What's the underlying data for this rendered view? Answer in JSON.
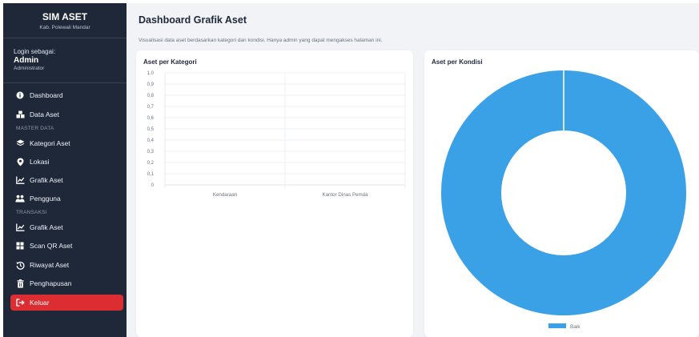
{
  "brand": {
    "title": "SIM ASET",
    "subtitle": "Kab. Polewali Mandar"
  },
  "login": {
    "label": "Login sebagai:",
    "name": "Admin",
    "role": "Administrator"
  },
  "sidebar": {
    "items": [
      {
        "label": "Dashboard",
        "icon": "info-circle-icon"
      },
      {
        "label": "Data Aset",
        "icon": "boxes-icon"
      },
      {
        "label": "Kategori Aset",
        "icon": "layers-icon"
      },
      {
        "label": "Lokasi",
        "icon": "map-pin-icon"
      },
      {
        "label": "Grafik Aset",
        "icon": "line-chart-icon"
      },
      {
        "label": "Pengguna",
        "icon": "users-icon"
      },
      {
        "label": "Grafik Aset",
        "icon": "line-chart-icon"
      },
      {
        "label": "Scan QR Aset",
        "icon": "qr-code-icon"
      },
      {
        "label": "Riwayat Aset",
        "icon": "history-icon"
      },
      {
        "label": "Penghapusan",
        "icon": "trash-icon"
      },
      {
        "label": "Keluar",
        "icon": "logout-icon"
      }
    ],
    "sections": {
      "master": "MASTER DATA",
      "transaksi": "TRANSAKSI"
    }
  },
  "header": {
    "title": "Dashboard Grafik Aset",
    "subtitle": "Visualisasi data aset berdasarkan kategori dan kondisi. Hanya admin yang dapat mengakses halaman ini."
  },
  "colors": {
    "sidebar_bg": "#1f2838",
    "accent": "#3ba1e6",
    "logout": "#dc2d32"
  },
  "chart_data": [
    {
      "type": "bar",
      "title": "Aset per Kategori",
      "categories": [
        "Kendaraan",
        "Kantor Dinas Pemda"
      ],
      "values": [
        0,
        0
      ],
      "yticks": [
        "1,0",
        "0,9",
        "0,8",
        "0,7",
        "0,6",
        "0,5",
        "0,4",
        "0,3",
        "0,2",
        "0,1",
        "0"
      ],
      "ylim": [
        0,
        1
      ],
      "grid": true
    },
    {
      "type": "pie",
      "title": "Aset per Kondisi",
      "labels": [
        "Baik"
      ],
      "values": [
        1
      ],
      "colors": [
        "#3ba1e6"
      ],
      "legend": "bottom"
    }
  ]
}
